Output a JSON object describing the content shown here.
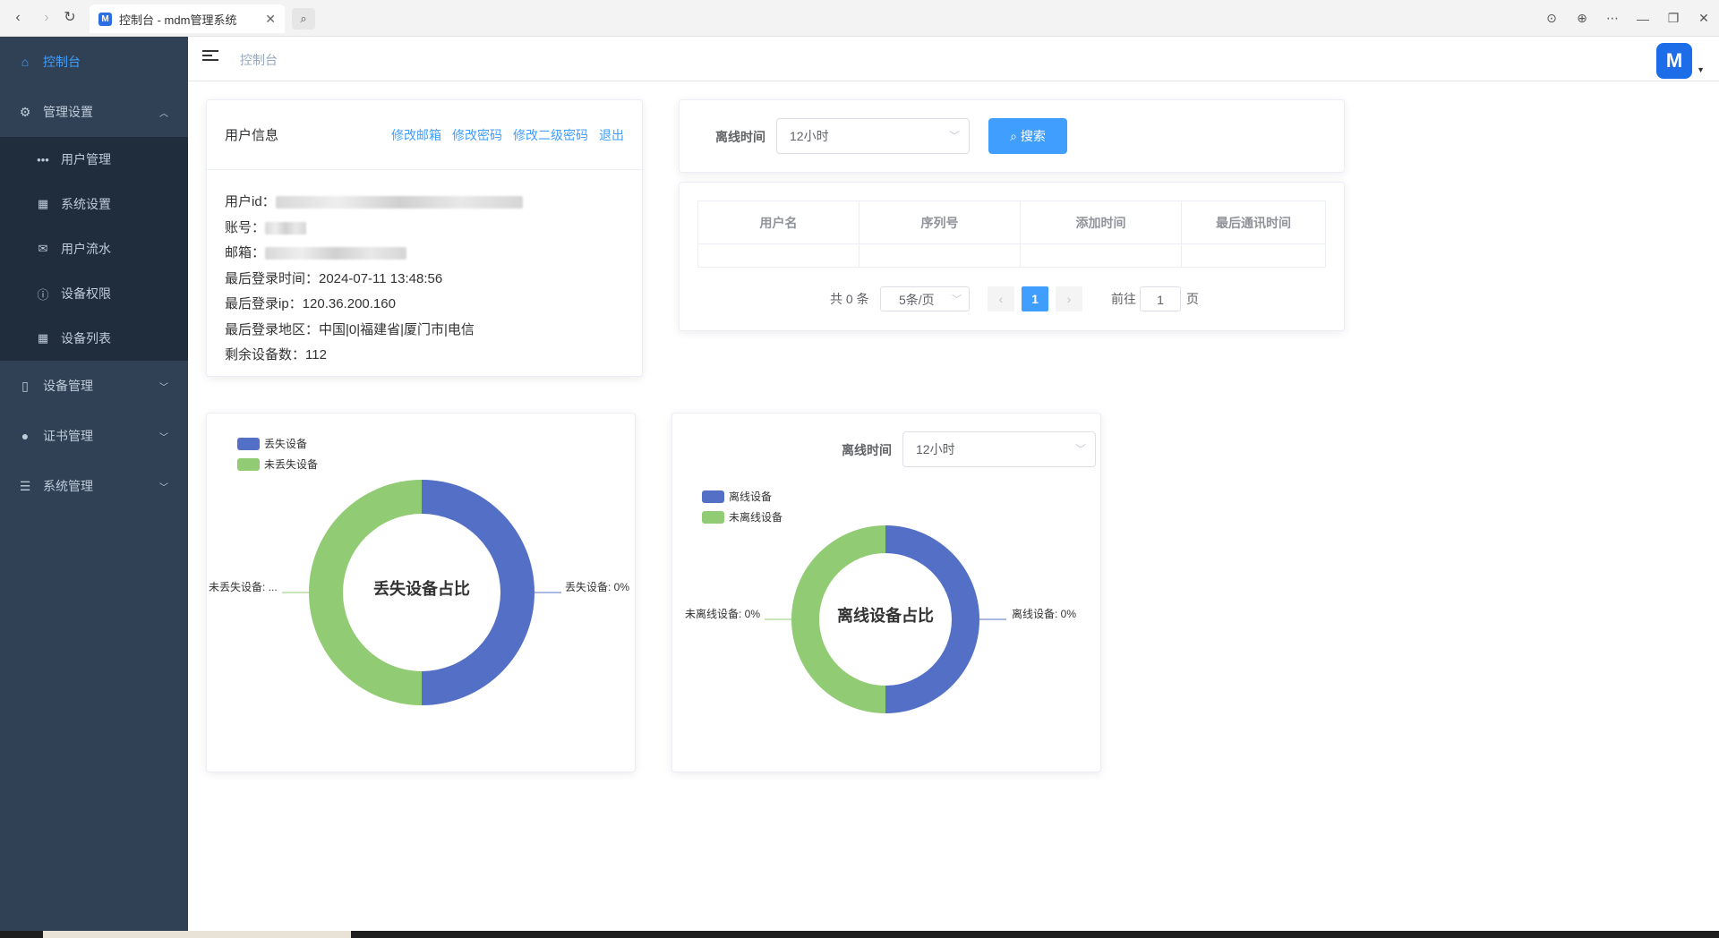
{
  "browser": {
    "tab_title": "控制台 - mdm管理系统",
    "favicon_text": "M",
    "close_glyph": "✕",
    "icons": [
      "back-icon",
      "forward-icon",
      "reload-icon",
      "search-icon",
      "download-icon",
      "globe-icon",
      "more-icon",
      "minimize-icon",
      "restore-icon",
      "close-icon"
    ]
  },
  "sidebar": {
    "dashboard": "控制台",
    "admin_settings": "管理设置",
    "admin_items": [
      "用户管理",
      "系统设置",
      "用户流水",
      "设备权限",
      "设备列表"
    ],
    "device_mgmt": "设备管理",
    "cert_mgmt": "证书管理",
    "system_mgmt": "系统管理"
  },
  "header": {
    "breadcrumb": "控制台",
    "avatar_text": "M"
  },
  "user_info": {
    "title": "用户信息",
    "links": [
      "修改邮箱",
      "修改密码",
      "修改二级密码",
      "退出"
    ],
    "user_id_label": "用户id：",
    "account_label": "账号：",
    "email_label": "邮箱：",
    "last_login_time": "最后登录时间：2024-07-11 13:48:56",
    "last_login_ip": "最后登录ip：120.36.200.160",
    "last_login_region": "最后登录地区：中国|0|福建省|厦门市|电信",
    "remaining_devices": "剩余设备数：112"
  },
  "filter": {
    "label": "离线时间",
    "selected": "12小时",
    "search_button": "搜索"
  },
  "table": {
    "columns": [
      "用户名",
      "序列号",
      "添加时间",
      "最后通讯时间"
    ],
    "rows": []
  },
  "pagination": {
    "total": "共 0 条",
    "page_size": "5条/页",
    "current_page": "1",
    "goto_label": "前往",
    "goto_value": "1",
    "page_suffix": "页"
  },
  "chart_lost": {
    "legend": [
      "丢失设备",
      "未丢失设备"
    ],
    "center_title": "丢失设备占比",
    "label_right": "丢失设备: 0%",
    "label_left": "未丢失设备: ..."
  },
  "chart_offline": {
    "filter_label": "离线时间",
    "filter_selected": "12小时",
    "legend": [
      "离线设备",
      "未离线设备"
    ],
    "center_title": "离线设备占比",
    "label_right": "离线设备: 0%",
    "label_left": "未离线设备: 0%"
  },
  "colors": {
    "series_blue": "#5470c6",
    "series_green": "#91cc75",
    "primary": "#409eff",
    "sidebar_bg": "#304156"
  },
  "chart_data": [
    {
      "type": "pie",
      "title": "丢失设备占比",
      "categories": [
        "丢失设备",
        "未丢失设备"
      ],
      "values": [
        50,
        50
      ]
    },
    {
      "type": "pie",
      "title": "离线设备占比",
      "categories": [
        "离线设备",
        "未离线设备"
      ],
      "values": [
        50,
        50
      ]
    }
  ]
}
